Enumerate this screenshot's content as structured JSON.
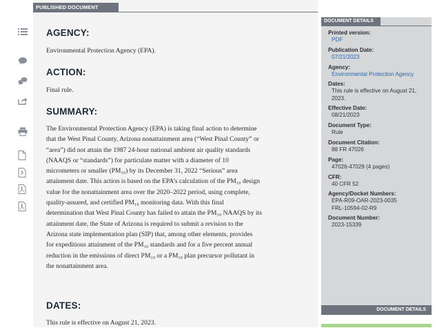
{
  "doc_tab": "PUBLISHED DOCUMENT",
  "sections": {
    "agency": {
      "heading": "AGENCY:",
      "text": "Environmental Protection Agency (EPA)."
    },
    "action": {
      "heading": "ACTION:",
      "text": "Final rule."
    },
    "summary": {
      "heading": "SUMMARY:",
      "lines": [
        "The Environmental Protection Agency (EPA) is taking final action to determine",
        "that the West Pinal County, Arizona nonattainment area (“West Pinal County” or",
        "“area”) did not attain the 1987 24-hour national ambient air quality standards",
        "(NAAQS or “standards”) for particulate matter with a diameter of 10",
        "micrometers or smaller (PM₁₀) by its December 31, 2022 “Serious” area",
        "attainment date. This action is based on the EPA’s calculation of the PM₁₀ design",
        "value for the nonattainment area over the 2020–2022 period, using complete,",
        "quality-assured, and certified PM₁₀ monitoring data. With this final",
        "determination that West Pinal County has failed to attain the PM₁₀ NAAQS by its",
        "attainment date, the State of Arizona is required to submit a revision to the",
        "Arizona state implementation plan (SIP) that, among other elements, provides",
        "for expeditious attainment of the PM₁₀ standards and for a five percent annual",
        "reduction in the emissions of direct PM₁₀ or a PM₁₀ plan precursor pollutant in",
        "the nonattainment area."
      ]
    },
    "dates": {
      "heading": "DATES:",
      "text": "This rule is effective on August 21, 2023."
    }
  },
  "details": {
    "tab": "DOCUMENT DETAILS",
    "footer": "DOCUMENT DETAILS",
    "items": [
      {
        "label": "Printed version:",
        "value": "PDF",
        "link": true
      },
      {
        "label": "Publication Date:",
        "value": "07/21/2023",
        "link": true
      },
      {
        "label": "Agency:",
        "value": "Environmental Protection Agency",
        "link": true
      },
      {
        "label": "Dates:",
        "value": "This rule is effective on August 21, 2023.",
        "link": false
      },
      {
        "label": "Effective Date:",
        "value": "08/21/2023",
        "link": false
      },
      {
        "label": "Document Type:",
        "value": "Rule",
        "link": false
      },
      {
        "label": "Document Citation:",
        "value": "88 FR 47026",
        "link": false
      },
      {
        "label": "Page:",
        "value": "47026-47029 (4 pages)",
        "link": false
      },
      {
        "label": "CFR:",
        "value": "40 CFR 52",
        "link": false
      },
      {
        "label": "Agency/Docket Numbers:",
        "value": "EPA-R09-OAR-2023-0035\nFRL-10594-02-R9",
        "link": false
      },
      {
        "label": "Document Number:",
        "value": "2023-15339",
        "link": false
      }
    ]
  },
  "icons": [
    "list-icon",
    "comment-icon",
    "comments-icon",
    "share-icon",
    "print-icon",
    "document-icon",
    "document-arrow-icon",
    "pdf-icon",
    "pdf-alt-icon"
  ],
  "colors": {
    "link": "#2a66b0",
    "tab": "#6e747d",
    "sidebar": "#d5d7d8",
    "page": "#f4f4f4"
  }
}
